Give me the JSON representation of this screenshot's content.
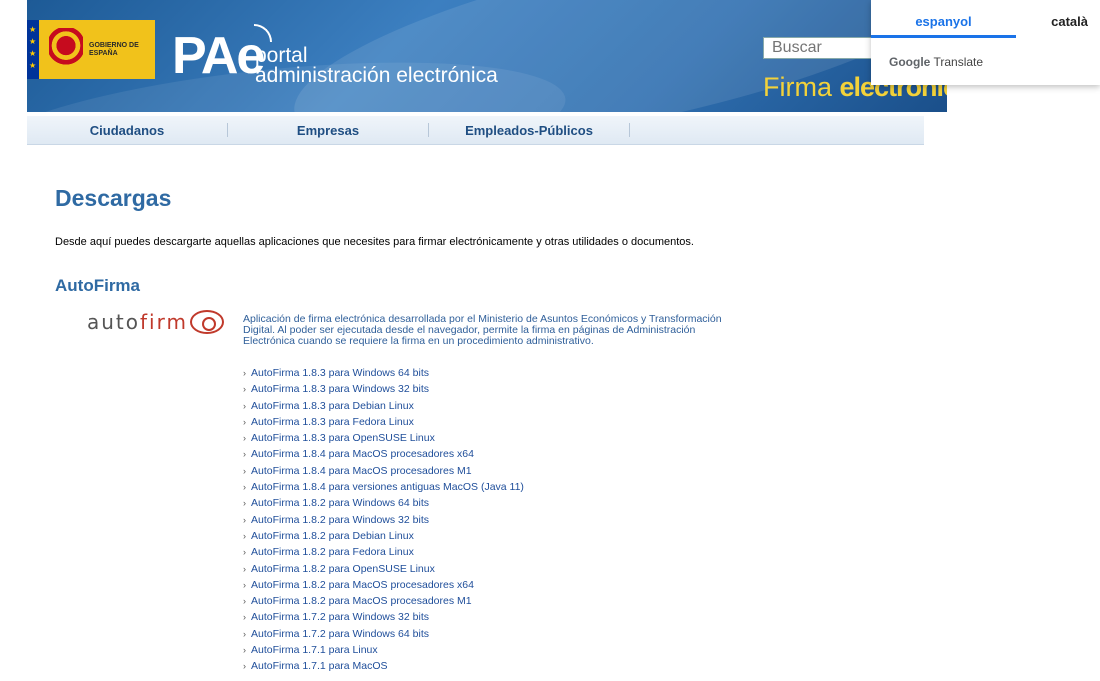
{
  "header": {
    "gov_logo_text": "GOBIERNO DE ESPAÑA",
    "pae_logo": "PAe",
    "portal_line1": "portal",
    "portal_line2": "administración electrónica",
    "search_placeholder": "Buscar",
    "firma_text1": "Firma",
    "firma_text2": "electrónica"
  },
  "translate": {
    "tab_active": "espanyol",
    "tab_other": "català",
    "brand": "Google",
    "brand_suffix": "Translate"
  },
  "nav": {
    "items": [
      "Ciudadanos",
      "Empresas",
      "Empleados-Públicos"
    ]
  },
  "page": {
    "title": "Descargas",
    "intro": "Desde aquí puedes descargarte aquellas aplicaciones que necesites para firmar electrónicamente y otras utilidades o documentos.",
    "section_title": "AutoFirma",
    "logo_text_grey": "auto",
    "logo_text_red": "firm",
    "description": "Aplicación de firma electrónica desarrollada por el Ministerio de Asuntos Económicos y Transformación Digital. Al poder ser ejecutada desde el navegador, permite la firma en páginas de Administración Electrónica cuando se requiere la firma en un procedimiento administrativo."
  },
  "downloads": [
    "AutoFirma 1.8.3 para Windows 64 bits",
    "AutoFirma 1.8.3 para Windows 32 bits",
    "AutoFirma 1.8.3 para Debian Linux",
    "AutoFirma 1.8.3 para Fedora Linux",
    "AutoFirma 1.8.3 para OpenSUSE Linux",
    "AutoFirma 1.8.4 para MacOS procesadores x64",
    "AutoFirma 1.8.4 para MacOS procesadores M1",
    "AutoFirma 1.8.4 para versiones antiguas MacOS (Java 11)",
    "AutoFirma 1.8.2 para Windows 64 bits",
    "AutoFirma 1.8.2 para Windows 32 bits",
    "AutoFirma 1.8.2 para Debian Linux",
    "AutoFirma 1.8.2 para Fedora Linux",
    "AutoFirma 1.8.2 para OpenSUSE Linux",
    "AutoFirma 1.8.2 para MacOS procesadores x64",
    "AutoFirma 1.8.2 para MacOS procesadores M1",
    "AutoFirma 1.7.2 para Windows 32 bits",
    "AutoFirma 1.7.2 para Windows 64 bits",
    "AutoFirma 1.7.1 para Linux",
    "AutoFirma 1.7.1 para MacOS"
  ]
}
